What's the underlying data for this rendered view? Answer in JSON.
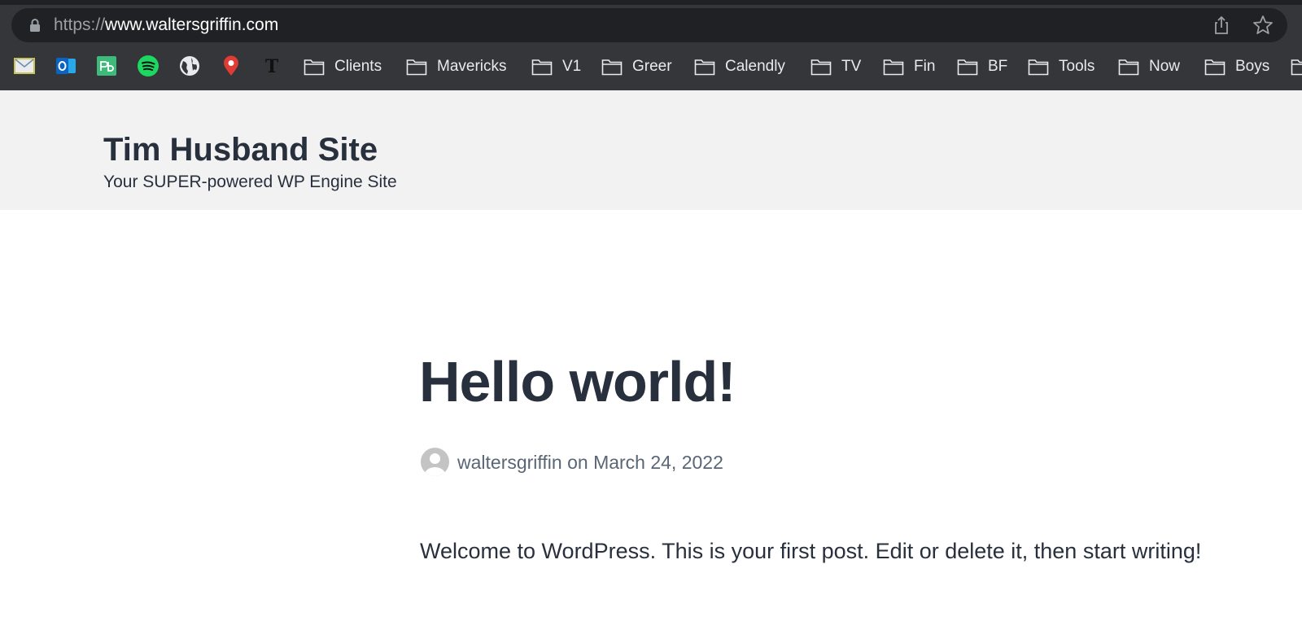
{
  "browser": {
    "url_scheme": "https://",
    "url_host": "www.waltersgriffin.com",
    "bookmark_icons": [
      "mail-icon",
      "outlook-icon",
      "pandadoc-icon",
      "spotify-icon",
      "globe-icon",
      "maps-pin-icon",
      "nytimes-icon"
    ],
    "bookmark_folders": [
      "Clients",
      "Mavericks",
      "V1",
      "Greer",
      "Calendly",
      "TV",
      "Fin",
      "BF",
      "Tools",
      "Now",
      "Boys"
    ],
    "colors": {
      "chrome": "#35363a",
      "omnibox": "#202124"
    }
  },
  "site": {
    "title": "Tim Husband Site",
    "tagline": "Your SUPER-powered WP Engine Site"
  },
  "post": {
    "title": "Hello world!",
    "author": "waltersgriffin",
    "date_prefix": "on",
    "date": "March 24, 2022",
    "content": "Welcome to WordPress. This is your first post. Edit or delete it, then start writing!"
  },
  "colors": {
    "text": "#28303d",
    "meta": "#5a6675",
    "header_bg": "#f2f2f2"
  }
}
